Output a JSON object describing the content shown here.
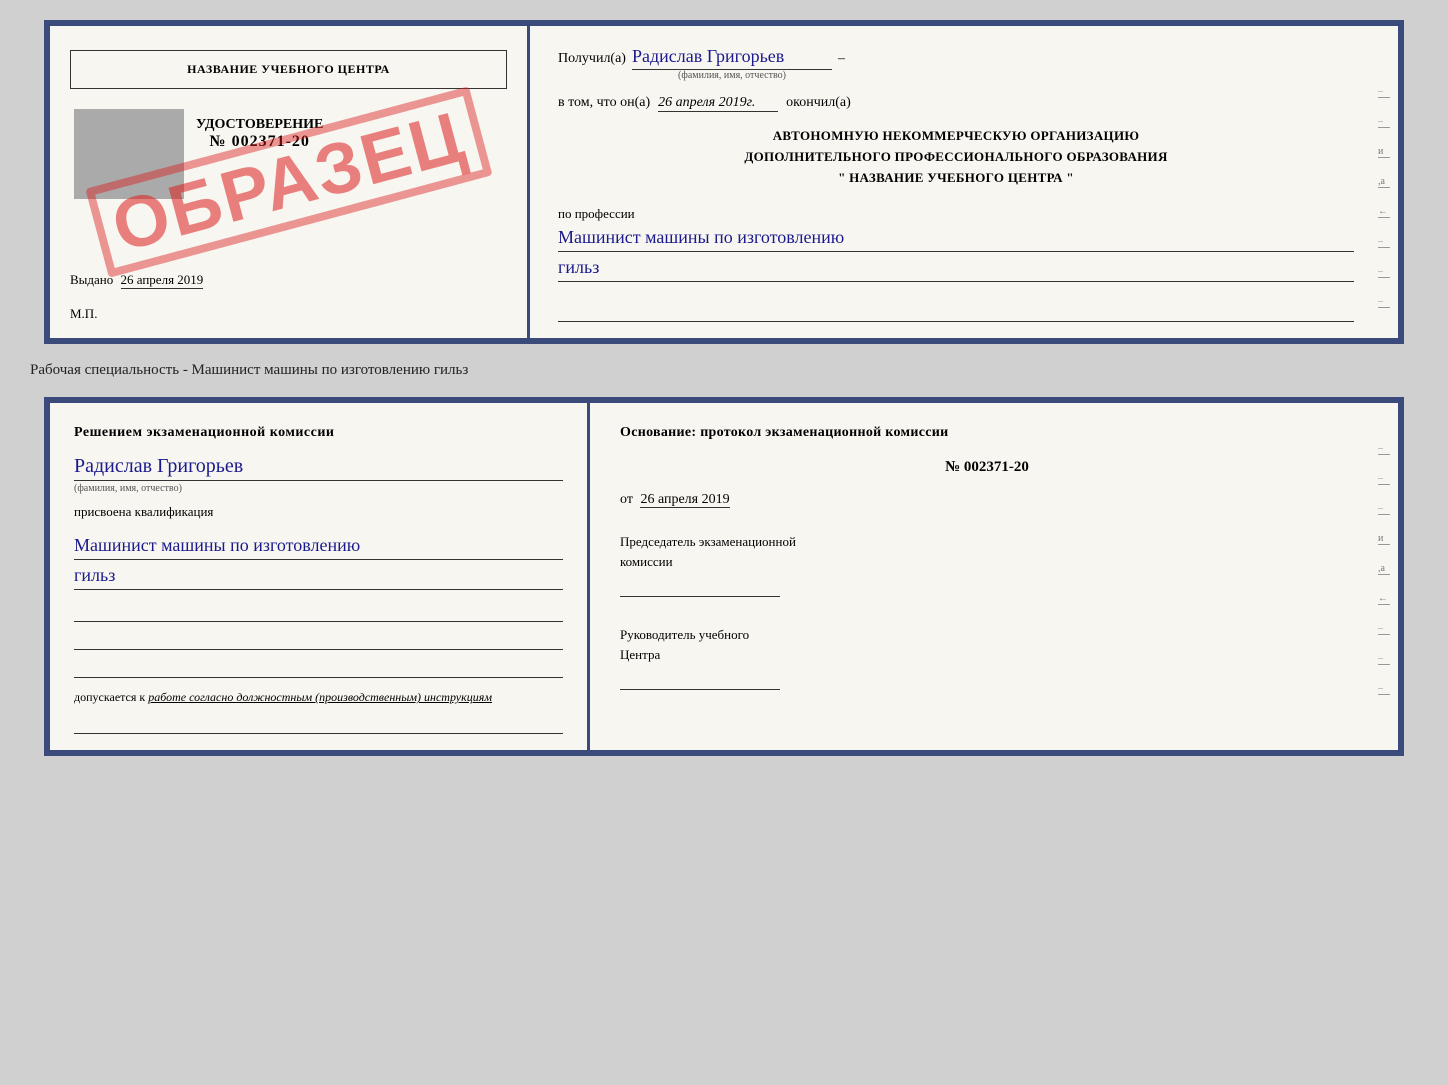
{
  "doc1": {
    "left": {
      "school_name": "НАЗВАНИЕ УЧЕБНОГО ЦЕНТРА",
      "cert_title": "УДОСТОВЕРЕНИЕ",
      "cert_number": "№ 002371-20",
      "issued_label": "Выдано",
      "issued_date": "26 апреля 2019",
      "mp_label": "М.П.",
      "stamp_text": "ОБРАЗЕЦ"
    },
    "right": {
      "received_prefix": "Получил(а)",
      "received_name": "Радислав Григорьев",
      "fio_caption": "(фамилия, имя, отчество)",
      "date_prefix": "в том, что он(а)",
      "date_value": "26 апреля 2019г.",
      "finished_label": "окончил(а)",
      "org_line1": "АВТОНОМНУЮ НЕКОММЕРЧЕСКУЮ ОРГАНИЗАЦИЮ",
      "org_line2": "ДОПОЛНИТЕЛЬНОГО ПРОФЕССИОНАЛЬНОГО ОБРАЗОВАНИЯ",
      "org_line3": "\"  НАЗВАНИЕ УЧЕБНОГО ЦЕНТРА  \"",
      "profession_label": "по профессии",
      "profession_handwritten1": "Машинист машины по изготовлению",
      "profession_handwritten2": "гильз"
    }
  },
  "specialty_label": "Рабочая специальность - Машинист машины по изготовлению гильз",
  "doc2": {
    "left": {
      "decision_title": "Решением  экзаменационной  комиссии",
      "person_name": "Радислав Григорьев",
      "fio_caption": "(фамилия, имя, отчество)",
      "assigned_label": "присвоена квалификация",
      "qual_line1": "Машинист машины по изготовлению",
      "qual_line2": "гильз",
      "admission_prefix": "допускается к",
      "admission_text": "работе согласно должностным (производственным) инструкциям"
    },
    "right": {
      "basis_title": "Основание: протокол экзаменационной  комиссии",
      "protocol_number": "№  002371-20",
      "date_prefix": "от",
      "date_value": "26 апреля 2019",
      "chairman_label1": "Председатель экзаменационной",
      "chairman_label2": "комиссии",
      "director_label1": "Руководитель учебного",
      "director_label2": "Центра"
    }
  },
  "margin_items": [
    "–",
    "–",
    "и",
    ",а",
    "←",
    "–",
    "–",
    "–"
  ],
  "margin_items2": [
    "–",
    "–",
    "–",
    "и",
    ",а",
    "←",
    "–",
    "–",
    "–"
  ]
}
